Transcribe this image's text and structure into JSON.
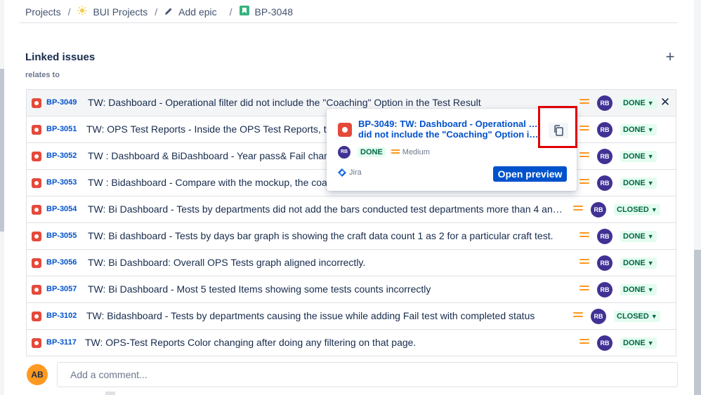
{
  "breadcrumb": {
    "items": [
      "Projects",
      "BUI Projects",
      "Add epic",
      "BP-3048"
    ],
    "separator": "/"
  },
  "linked": {
    "title": "Linked issues",
    "add_icon": "+",
    "relation": "relates to"
  },
  "issues": [
    {
      "key": "BP-3049",
      "summary": "TW: Dashboard - Operational filter did not include the \"Coaching\" Option in the Test Result",
      "avatar": "RB",
      "status": "DONE"
    },
    {
      "key": "BP-3051",
      "summary": "TW: OPS Test Reports - Inside the OPS Test Reports, the \"Co",
      "avatar": "RB",
      "status": "DONE"
    },
    {
      "key": "BP-3052",
      "summary": "TW : Dashboard & BiDashboard - Year pass& Fail charts nam",
      "avatar": "RB",
      "status": "DONE"
    },
    {
      "key": "BP-3053",
      "summary": "TW : Bidashboard - Compare with the mockup, the coaching",
      "avatar": "RB",
      "status": "DONE"
    },
    {
      "key": "BP-3054",
      "summary": "TW: Bi Dashboard - Tests by departments did not add the bars conducted test departments more than 4 and did no...",
      "avatar": "RB",
      "status": "CLOSED"
    },
    {
      "key": "BP-3055",
      "summary": "TW: Bi dashboard - Tests by days bar graph is showing the craft data count 1 as 2 for a particular craft test.",
      "avatar": "RB",
      "status": "DONE"
    },
    {
      "key": "BP-3056",
      "summary": "TW: Bi Dashboard: Overall OPS Tests graph aligned incorrectly.",
      "avatar": "RB",
      "status": "DONE"
    },
    {
      "key": "BP-3057",
      "summary": "TW: Bi Dashboard - Most 5 tested Items showing some tests counts incorrectly",
      "avatar": "RB",
      "status": "DONE"
    },
    {
      "key": "BP-3102",
      "summary": "TW: Bidashboard - Tests by departments causing the issue while adding Fail test with completed status",
      "avatar": "RB",
      "status": "CLOSED"
    },
    {
      "key": "BP-3117",
      "summary": "TW: OPS-Test Reports Color changing after doing any filtering on that page.",
      "avatar": "RB",
      "status": "DONE"
    }
  ],
  "row_close": "✕",
  "popup": {
    "title_line1": "BP-3049: TW: Dashboard - Operational filter",
    "title_line2": "did not include the \"Coaching\" Option in th...",
    "avatar": "RB",
    "status": "DONE",
    "priority": "Medium",
    "source": "Jira",
    "open_label": "Open preview"
  },
  "comment": {
    "avatar": "AB",
    "placeholder": "Add a comment..."
  },
  "colors": {
    "bug": "#e5493a",
    "link": "#0052cc",
    "priority_medium": "#ff991f",
    "avatar_rb": "#403294",
    "status_done_bg": "#e3fcef",
    "highlight": "#e00000"
  }
}
